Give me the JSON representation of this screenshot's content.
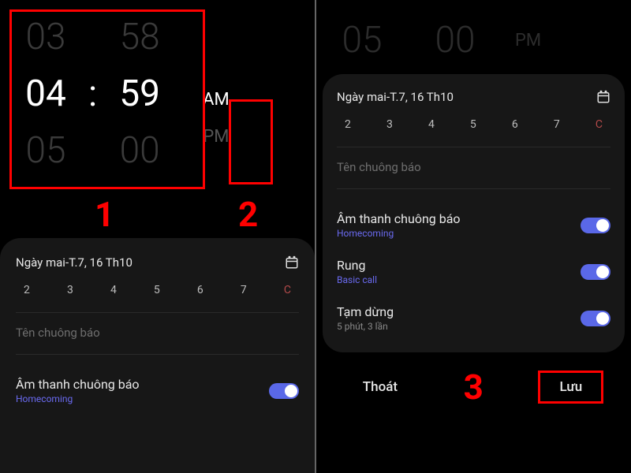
{
  "left": {
    "timePicker": {
      "hour_prev": "03",
      "hour_sel": "04",
      "hour_next": "05",
      "min_prev": "58",
      "min_sel": "59",
      "min_next": "00",
      "am": "AM",
      "pm": "PM"
    },
    "date": "Ngày mai-T.7, 16 Th10",
    "days": [
      "2",
      "3",
      "4",
      "5",
      "6",
      "7",
      "C"
    ],
    "nameLabel": "Tên chuông báo",
    "sound": {
      "title": "Âm thanh chuông báo",
      "sub": "Homecoming"
    }
  },
  "right": {
    "timePicker": {
      "hour": "05",
      "min": "00",
      "pm": "PM"
    },
    "date": "Ngày mai-T.7, 16 Th10",
    "days": [
      "2",
      "3",
      "4",
      "5",
      "6",
      "7",
      "C"
    ],
    "nameLabel": "Tên chuông báo",
    "sound": {
      "title": "Âm thanh chuông báo",
      "sub": "Homecoming"
    },
    "vibe": {
      "title": "Rung",
      "sub": "Basic call"
    },
    "snooze": {
      "title": "Tạm dừng",
      "sub": "5 phút, 3 lần"
    },
    "footer": {
      "cancel": "Thoát",
      "save": "Lưu"
    }
  },
  "annotations": {
    "n1": "1",
    "n2": "2",
    "n3": "3"
  }
}
